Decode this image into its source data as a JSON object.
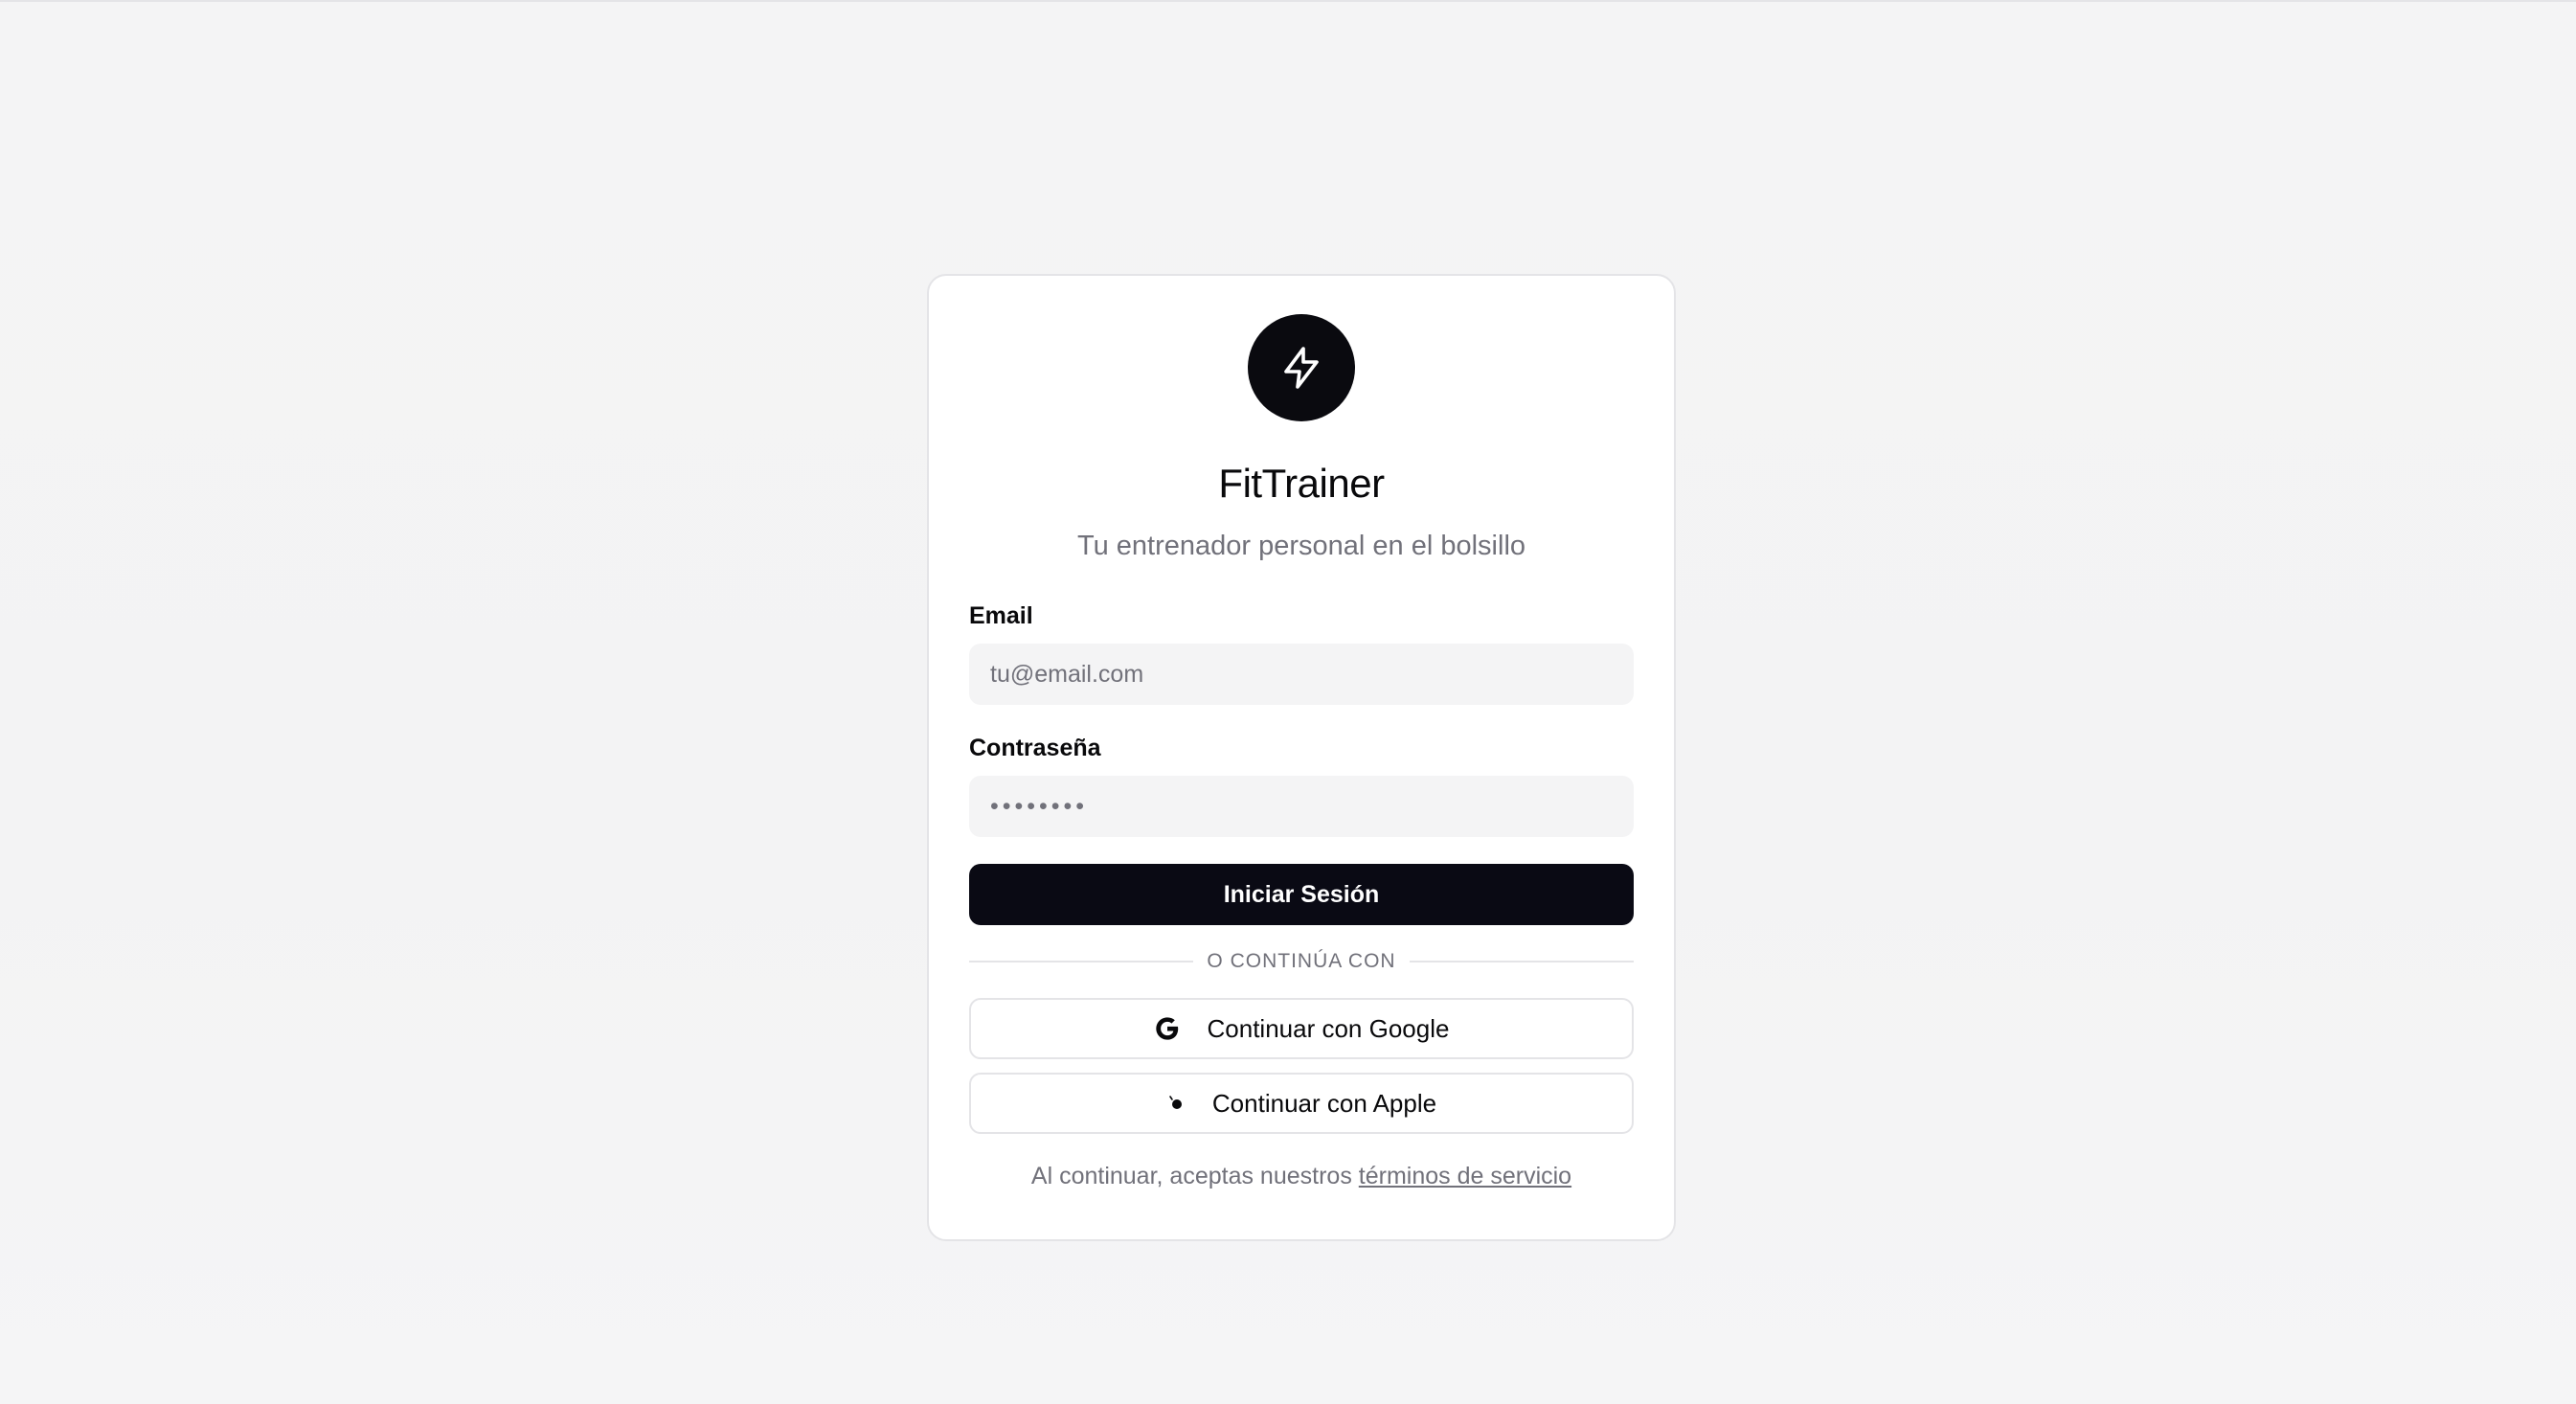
{
  "app": {
    "title": "FitTrainer",
    "subtitle": "Tu entrenador personal en el bolsillo",
    "logo_icon": "lightning-bolt-icon"
  },
  "form": {
    "email_label": "Email",
    "email_placeholder": "tu@email.com",
    "email_value": "",
    "password_label": "Contraseña",
    "password_placeholder": "••••••••",
    "password_value": "",
    "submit_label": "Iniciar Sesión"
  },
  "divider": {
    "text": "O CONTINÚA CON"
  },
  "social": {
    "google_label": "Continuar con Google",
    "google_icon": "google-icon",
    "apple_label": "Continuar con Apple",
    "apple_icon": "apple-icon"
  },
  "footer": {
    "text": "Al continuar, aceptas nuestros",
    "link_text": "términos de servicio"
  },
  "colors": {
    "primary": "#0a0a14",
    "muted_text": "#71717a",
    "input_bg": "#f4f4f5",
    "border": "#e4e4e7"
  }
}
